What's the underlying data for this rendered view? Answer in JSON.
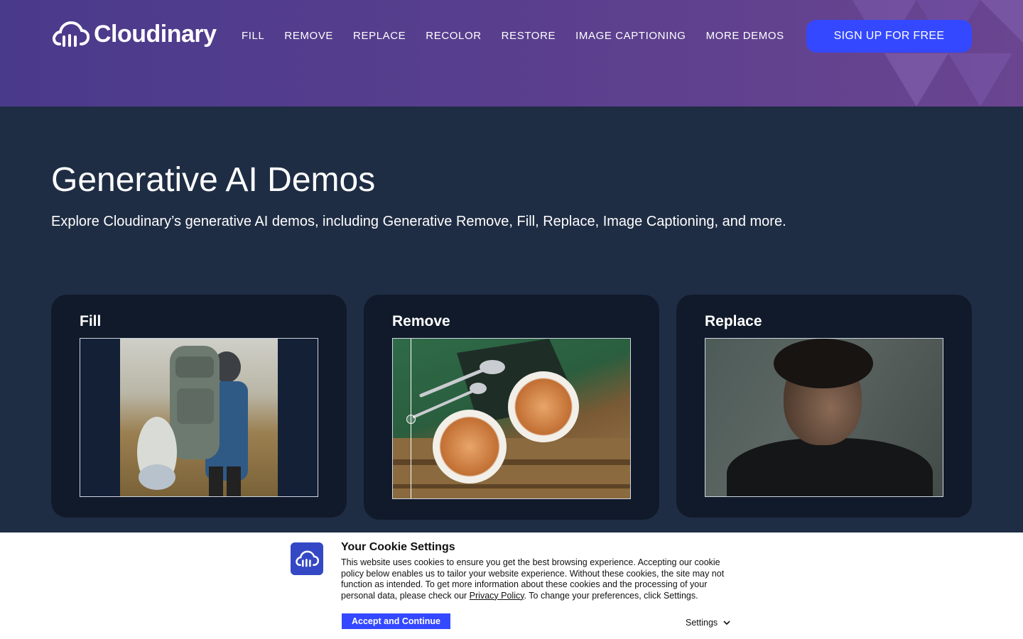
{
  "header": {
    "logo_text": "Cloudinary",
    "nav": [
      "FILL",
      "REMOVE",
      "REPLACE",
      "RECOLOR",
      "RESTORE",
      "IMAGE CAPTIONING",
      "MORE DEMOS"
    ],
    "signup_label": "SIGN UP FOR FREE"
  },
  "hero": {
    "title": "Generative AI Demos",
    "subtitle": "Explore Cloudinary’s generative AI demos, including Generative Remove, Fill, Replace, Image Captioning, and more."
  },
  "cards": [
    {
      "title": "Fill"
    },
    {
      "title": "Remove"
    },
    {
      "title": "Replace"
    }
  ],
  "cookie": {
    "title": "Your Cookie Settings",
    "text_before_link": "This website uses cookies to ensure you get the best browsing experience. Accepting our cookie policy below enables us to tailor your website experience. Without these cookies, the site may not function as intended. To get more information about these cookies and the processing of your personal data, please check our ",
    "link_label": "Privacy Policy",
    "text_after_link": ". To change your preferences, click Settings.",
    "accept_label": "Accept and Continue",
    "settings_label": "Settings"
  },
  "colors": {
    "accent": "#3448ff",
    "page_bg": "#1f2d44",
    "card_bg": "#111a2a"
  }
}
